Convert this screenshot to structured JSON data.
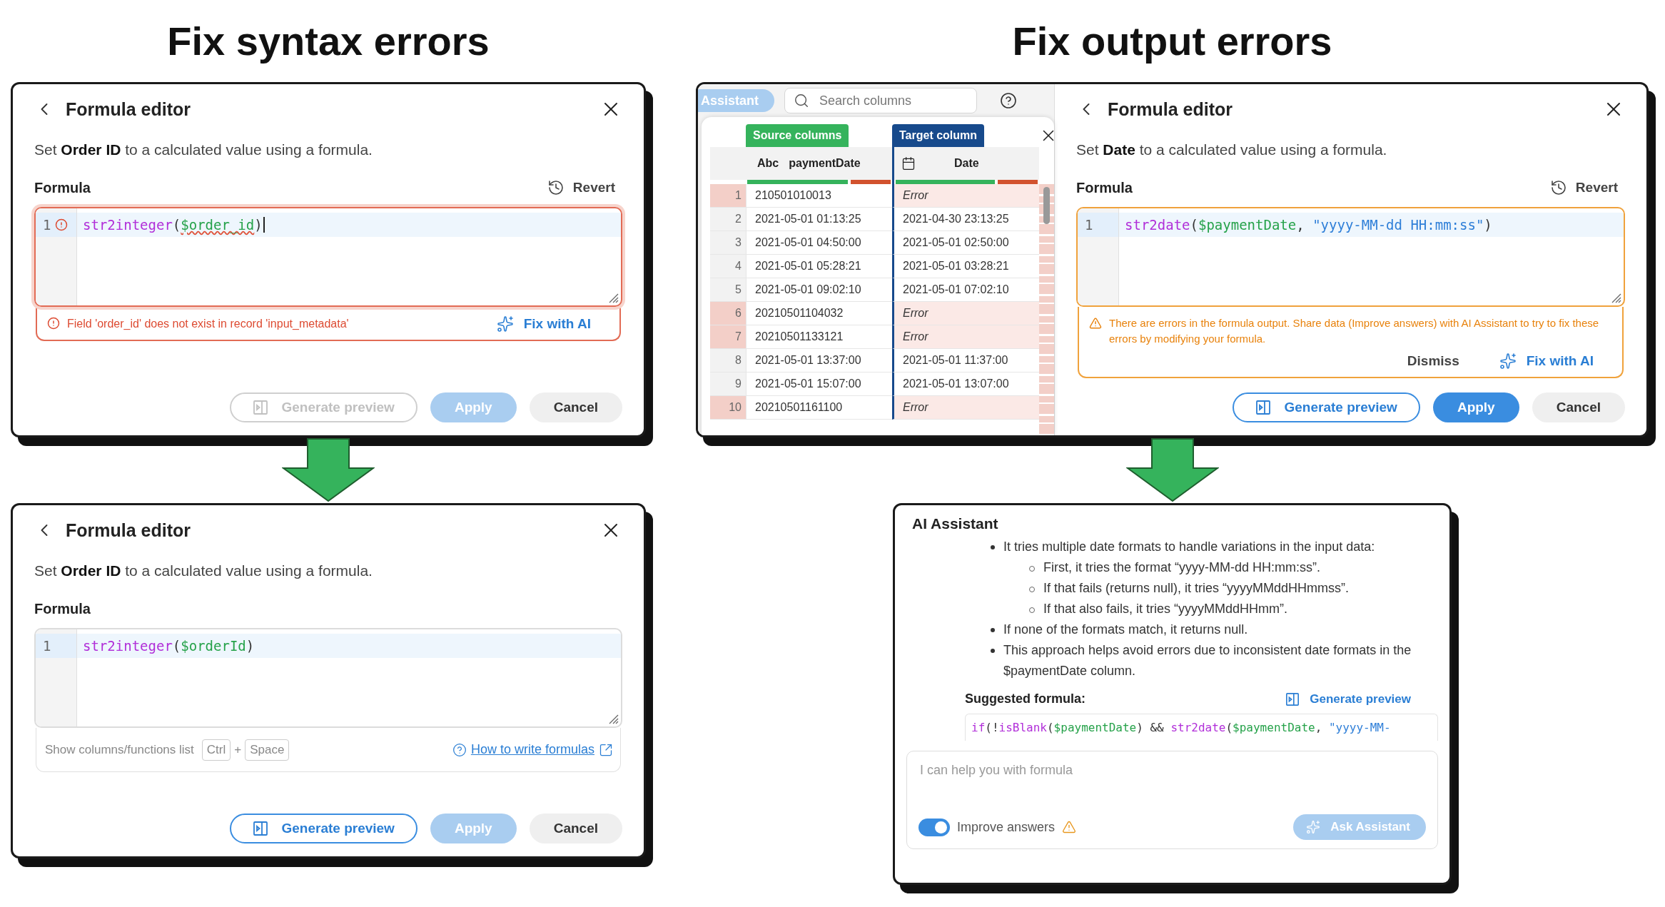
{
  "syntax_section": {
    "heading": "Fix syntax errors",
    "before": {
      "title": "Formula editor",
      "description": "Set **Order ID** to a calculated value using a formula.",
      "formula_label": "Formula",
      "revert_label": "Revert",
      "invalid": true,
      "warning": false,
      "line_number": "1",
      "line_error": true,
      "cursor": true,
      "code": [
        {
          "text": "str2integer",
          "kind": "function",
          "underlined": false
        },
        {
          "text": "(",
          "kind": "plain",
          "underlined": false
        },
        {
          "text": "$order_id",
          "kind": "field",
          "underlined": true
        },
        {
          "text": ")",
          "kind": "plain",
          "underlined": false
        }
      ],
      "message": {
        "kind": "error",
        "text": "Field 'order_id' does not exist in record 'input_metadata'",
        "fix_label": "Fix with AI"
      },
      "buttons": [
        {
          "label": "Generate preview",
          "kind": "outline",
          "disabled": true
        },
        {
          "label": "Apply",
          "kind": "primary",
          "disabled": true
        },
        {
          "label": "Cancel",
          "kind": "secondary",
          "disabled": false
        }
      ]
    },
    "after": {
      "title": "Formula editor",
      "description": "Set **Order ID** to a calculated value using a formula.",
      "formula_label": "Formula",
      "invalid": false,
      "warning": false,
      "line_number": "1",
      "cursor": false,
      "code": [
        {
          "text": "str2integer",
          "kind": "function"
        },
        {
          "text": "(",
          "kind": "plain"
        },
        {
          "text": "$orderId",
          "kind": "field"
        },
        {
          "text": ")",
          "kind": "plain"
        }
      ],
      "hint": {
        "text": "Show columns/functions list",
        "keys": [
          "Ctrl",
          "Space"
        ],
        "joiner": "+",
        "link": "How to write formulas"
      },
      "buttons": [
        {
          "label": "Generate preview",
          "kind": "outline",
          "disabled": false
        },
        {
          "label": "Apply",
          "kind": "primary",
          "disabled": true
        },
        {
          "label": "Cancel",
          "kind": "secondary",
          "disabled": false
        }
      ]
    }
  },
  "output_section": {
    "heading": "Fix output errors",
    "data_preview": {
      "assistant_button": "Assistant",
      "search_placeholder": "Search columns",
      "source_tab": "Source columns",
      "target_tab": "Target column",
      "source_column": {
        "type_label": "Abc",
        "name": "paymentDate",
        "level": 0.7
      },
      "target_column": {
        "name": "Date",
        "level": 0.7
      },
      "rows": [
        {
          "number": "1",
          "source": "210501010013",
          "target": "Error",
          "error": true
        },
        {
          "number": "2",
          "source": "2021-05-01 01:13:25",
          "target": "2021-04-30 23:13:25",
          "error": false
        },
        {
          "number": "3",
          "source": "2021-05-01 04:50:00",
          "target": "2021-05-01 02:50:00",
          "error": false
        },
        {
          "number": "4",
          "source": "2021-05-01 05:28:21",
          "target": "2021-05-01 03:28:21",
          "error": false
        },
        {
          "number": "5",
          "source": "2021-05-01 09:02:10",
          "target": "2021-05-01 07:02:10",
          "error": false
        },
        {
          "number": "6",
          "source": "20210501104032",
          "target": "Error",
          "error": true
        },
        {
          "number": "7",
          "source": "20210501133121",
          "target": "Error",
          "error": true
        },
        {
          "number": "8",
          "source": "2021-05-01 13:37:00",
          "target": "2021-05-01 11:37:00",
          "error": false
        },
        {
          "number": "9",
          "source": "2021-05-01 15:07:00",
          "target": "2021-05-01 13:07:00",
          "error": false
        },
        {
          "number": "10",
          "source": "20210501161100",
          "target": "Error",
          "error": true
        }
      ]
    },
    "editor": {
      "title": "Formula editor",
      "description": "Set **Date** to a calculated value using a formula.",
      "formula_label": "Formula",
      "revert_label": "Revert",
      "invalid": false,
      "warning": true,
      "line_number": "1",
      "cursor": false,
      "code": [
        {
          "text": "str2date",
          "kind": "function"
        },
        {
          "text": "(",
          "kind": "plain"
        },
        {
          "text": "$paymentDate",
          "kind": "field"
        },
        {
          "text": ", ",
          "kind": "plain"
        },
        {
          "text": "\"yyyy-MM-dd HH:mm:ss\"",
          "kind": "string"
        },
        {
          "text": ")",
          "kind": "plain"
        }
      ],
      "message": {
        "kind": "warning",
        "text": "There are errors in the formula output. Share data (Improve answers) with AI Assistant to try to fix these errors by modifying your formula.",
        "dismiss_label": "Dismiss",
        "fix_label": "Fix with AI"
      },
      "buttons": [
        {
          "label": "Generate preview",
          "kind": "outline",
          "disabled": false
        },
        {
          "label": "Apply",
          "kind": "primary",
          "disabled": false
        },
        {
          "label": "Cancel",
          "kind": "secondary",
          "disabled": false
        }
      ]
    },
    "assistant": {
      "title": "AI Assistant",
      "bullets": [
        {
          "text": "It tries multiple date formats to handle variations in the input data:",
          "children": [
            {
              "text": "First, it tries the format “yyyy-MM-dd HH:mm:ss”."
            },
            {
              "text": "If that fails (returns null), it tries “yyyyMMddHHmmss”."
            },
            {
              "text": "If that also fails, it tries “yyyyMMddHHmm”."
            }
          ]
        },
        {
          "text": "If none of the formats match, it returns null."
        },
        {
          "text": "This approach helps avoid errors due to inconsistent date formats in the $paymentDate column."
        }
      ],
      "suggested_label": "Suggested formula:",
      "preview_label": "Generate preview",
      "code": [
        {
          "text": "if",
          "kind": "function"
        },
        {
          "text": "(!",
          "kind": "plain"
        },
        {
          "text": "isBlank",
          "kind": "function"
        },
        {
          "text": "(",
          "kind": "plain"
        },
        {
          "text": "$paymentDate",
          "kind": "field"
        },
        {
          "text": ") && ",
          "kind": "plain"
        },
        {
          "text": "str2date",
          "kind": "function"
        },
        {
          "text": "(",
          "kind": "plain"
        },
        {
          "text": "$paymentDate",
          "kind": "field"
        },
        {
          "text": ", ",
          "kind": "plain"
        },
        {
          "text": "\"yyyy-MM-",
          "kind": "string"
        }
      ],
      "input_placeholder": "I can help you with formula",
      "toggle": {
        "label": "Improve answers",
        "on": true
      },
      "ask_label": "Ask Assistant",
      "ask_disabled": true
    }
  }
}
